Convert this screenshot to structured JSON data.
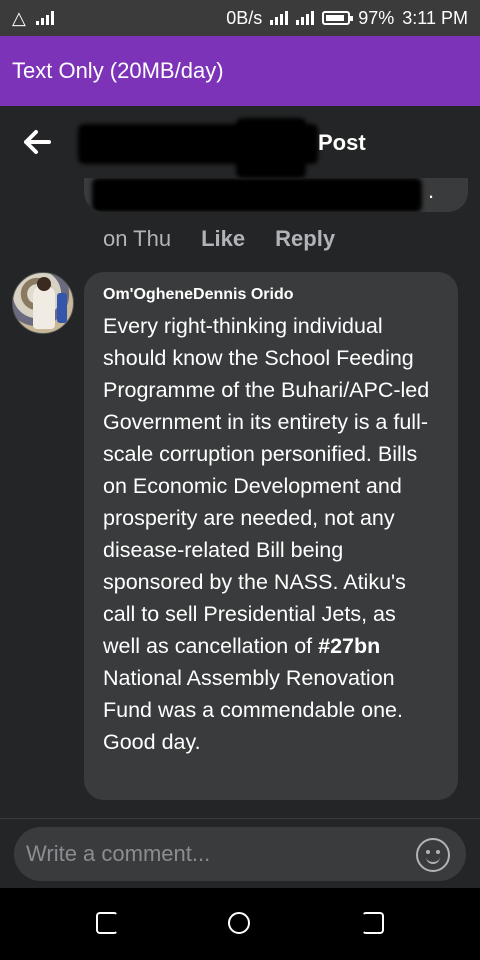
{
  "status_bar": {
    "data_rate": "0B/s",
    "battery_percent": "97%",
    "time": "3:11 PM"
  },
  "banner": {
    "text": "Text Only (20MB/day)"
  },
  "header": {
    "title": "Post",
    "back_icon": "arrow-left-icon"
  },
  "previous_comment": {
    "time": "on Thu",
    "like_label": "Like",
    "reply_label": "Reply"
  },
  "comment": {
    "author": "Om'OgheneDennis Orido",
    "text_before": "Every right-thinking individual should know the School Feeding Programme of the Buhari/APC-led Government in its entirety is a full-scale corruption personified. Bills on Economic Development and prosperity are needed, not any disease-related Bill being sponsored by the NASS. Atiku's call to sell Presidential Jets, as well as cancellation of ",
    "hashtag": "#27bn",
    "text_after": " National Assembly Renovation Fund was a commendable one. Good day."
  },
  "composer": {
    "placeholder": "Write a comment..."
  }
}
